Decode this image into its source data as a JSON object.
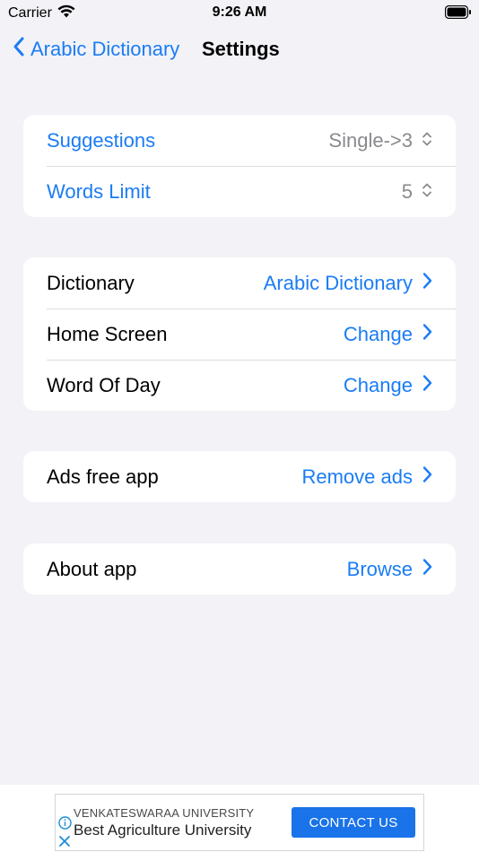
{
  "status_bar": {
    "carrier": "Carrier",
    "time": "9:26 AM"
  },
  "nav": {
    "back_label": "Arabic Dictionary",
    "title": "Settings"
  },
  "group1": {
    "suggestions": {
      "label": "Suggestions",
      "value": "Single->3"
    },
    "words_limit": {
      "label": "Words Limit",
      "value": "5"
    }
  },
  "group2": {
    "dictionary": {
      "label": "Dictionary",
      "value": "Arabic Dictionary"
    },
    "home_screen": {
      "label": "Home Screen",
      "value": "Change"
    },
    "word_of_day": {
      "label": "Word Of Day",
      "value": "Change"
    }
  },
  "group3": {
    "ads_free": {
      "label": "Ads free app",
      "value": "Remove ads"
    }
  },
  "group4": {
    "about": {
      "label": "About app",
      "value": "Browse"
    }
  },
  "ad": {
    "advertiser": "VENKATESWARAA UNIVERSITY",
    "headline": "Best Agriculture University",
    "cta": "CONTACT US"
  },
  "colors": {
    "accent": "#1a7cf5",
    "background": "#f2f2f7",
    "secondary_text": "#8a8a8e",
    "ad_button": "#1a73e8"
  },
  "icons": [
    "wifi-icon",
    "battery-icon",
    "chevron-left-icon",
    "chevron-right-icon",
    "up-down-chevron-icon",
    "info-icon",
    "close-icon"
  ]
}
